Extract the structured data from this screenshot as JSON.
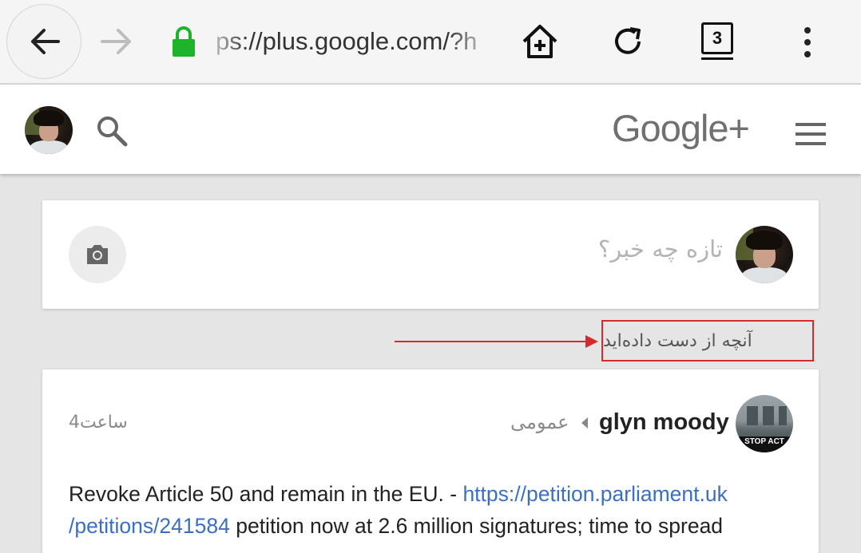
{
  "browser": {
    "url": "ps://plus.google.com/?h",
    "tab_count": "3",
    "icons": [
      "back-arrow-icon",
      "forward-arrow-icon",
      "lock-icon",
      "home-icon",
      "reload-icon",
      "tab-switcher-icon",
      "overflow-menu-icon"
    ]
  },
  "header": {
    "logo": "Google+",
    "icons": [
      "avatar",
      "search-icon",
      "hamburger-menu-icon"
    ]
  },
  "share": {
    "prompt": "تازه چه خبر؟",
    "icons": [
      "camera-icon"
    ]
  },
  "annotation": {
    "missed_label": "آنچه از دست داده‌اید",
    "color": "#d42a2a"
  },
  "post": {
    "author": "glyn moody",
    "visibility": "عمومی",
    "time": "4ساعت",
    "avatar_banner": "STOP ACT",
    "text_before_link": "Revoke Article 50 and remain in the EU.  - ",
    "link_line1": "https://petition.parliament.uk",
    "link_line2": "/petitions/241584",
    "text_after_link": " petition now at 2.6 million signatures; time to spread"
  },
  "colors": {
    "link": "#3a6fc4",
    "lock": "#1db32a",
    "background": "#e5e5e5"
  }
}
